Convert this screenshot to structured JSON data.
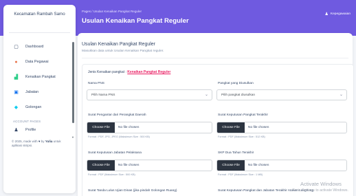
{
  "sidebar": {
    "brand": "Kecamatan Rambah Samo",
    "items": [
      {
        "label": "Dashboard",
        "icon": "tv-icon"
      },
      {
        "label": "Data Pegawai",
        "icon": "users-icon"
      },
      {
        "label": "Kenaikan Pangkat",
        "icon": "chart-icon"
      },
      {
        "label": "Jabatan",
        "icon": "id-card-icon"
      },
      {
        "label": "Golongan",
        "icon": "tag-icon"
      }
    ],
    "section_label": "ACCOUNT PAGES",
    "account_items": [
      {
        "label": "Profile",
        "icon": "user-icon"
      }
    ],
    "footer_prefix": "© 2025, made with",
    "footer_by": "by",
    "footer_author": "Yulia",
    "footer_suffix": "untuk aplikasi skripsi."
  },
  "header": {
    "breadcrumb": "Pages / Usulan Kenaikan Pangkat Reguler",
    "title": "Usulan Kenaikan Pangkat Reguler",
    "user_label": "Kepegawaian"
  },
  "card": {
    "title": "Usulan Kenaikan Pangkat Reguler",
    "subtitle": "Masukkan data untuk Usulan Kenaikan Pangkat reguler."
  },
  "form": {
    "jenis_label": "Jenis Kenaikan pangkat :",
    "jenis_value": "Kenaikan Pangkat Reguler",
    "nama_pns_label": "Nama PNS",
    "nama_pns_value": "Pilih Nama PNS",
    "pangkat_label": "Pangkat yang Diusulkan",
    "pangkat_value": "Pilih pangkat diusulkan",
    "files": [
      {
        "label": "Surat Pengantar dari Perangkat Daerah",
        "hint": "Format : PDF, JPG, JPEG (Maksimum Size : 500 KB)"
      },
      {
        "label": "Surat Keputusan Pangkat Terakhir",
        "hint": "Format : PDF (Maksimum Size : 512 KB)"
      },
      {
        "label": "Surat Keputusan Jabatan Pelaksana",
        "hint": "Format : PDF (Maksimum Size : 500 KB)"
      },
      {
        "label": "SKP Dua Tahun Terakhir",
        "hint": "Format : PDF (Maksimum Size : 1 MB)"
      },
      {
        "label": "Surat Tanda Lulus Ujian Dinas (jika pindah Golongan Ruang)"
      },
      {
        "label": "Surat Keputusan Pangkat dan Jabatan Terakhir Atasan Langsung"
      }
    ],
    "choose_file_label": "Choose File",
    "no_file_label": "No file chosen"
  },
  "os_overlay": {
    "title": "Activate Windows",
    "subtitle": "Go to Settings to activate Windows."
  },
  "colors": {
    "hero": "#6f5ae0",
    "accent_link": "#e91e63",
    "file_button": "#2c3440"
  }
}
